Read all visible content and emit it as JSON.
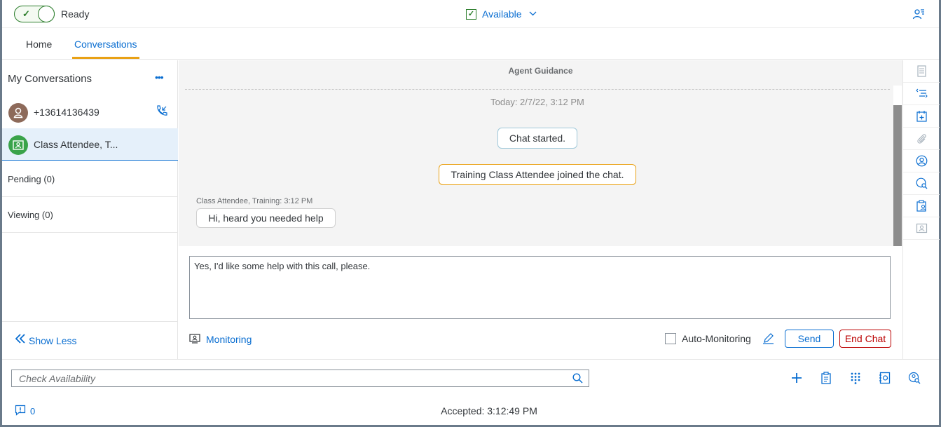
{
  "status": {
    "toggle_label": "Ready",
    "availability": "Available"
  },
  "tabs": [
    {
      "label": "Home",
      "active": false
    },
    {
      "label": "Conversations",
      "active": true
    }
  ],
  "left": {
    "title": "My Conversations",
    "more_icon": "•••",
    "conversations": [
      {
        "label": "+13614136439",
        "icon": "person-icon",
        "color": "#8d6a5a"
      },
      {
        "label": "Class Attendee, T...",
        "icon": "contact-card-icon",
        "color": "#3aa34a"
      }
    ],
    "pending": "Pending (0)",
    "viewing": "Viewing (0)",
    "show_less": "Show Less"
  },
  "chat": {
    "header": "Agent Guidance",
    "date": "Today: 2/7/22, 3:12 PM",
    "system_messages": [
      "Chat started.",
      "Training Class Attendee joined the chat."
    ],
    "message_meta": "Class Attendee, Training: 3:12 PM",
    "message_text": "Hi, heard you needed help",
    "input_value": "Yes, I'd like some help with this call, please."
  },
  "actions": {
    "monitoring": "Monitoring",
    "auto_monitoring": "Auto-Monitoring",
    "send": "Send",
    "end_chat": "End Chat"
  },
  "bottom": {
    "search_placeholder": "Check Availability",
    "notification_count": "0",
    "accepted": "Accepted: 3:12:49 PM"
  },
  "colors": {
    "accent": "#0a6ed1",
    "active_tab": "#e9a115",
    "end": "#bb0000",
    "ready": "#2b7d2b"
  }
}
